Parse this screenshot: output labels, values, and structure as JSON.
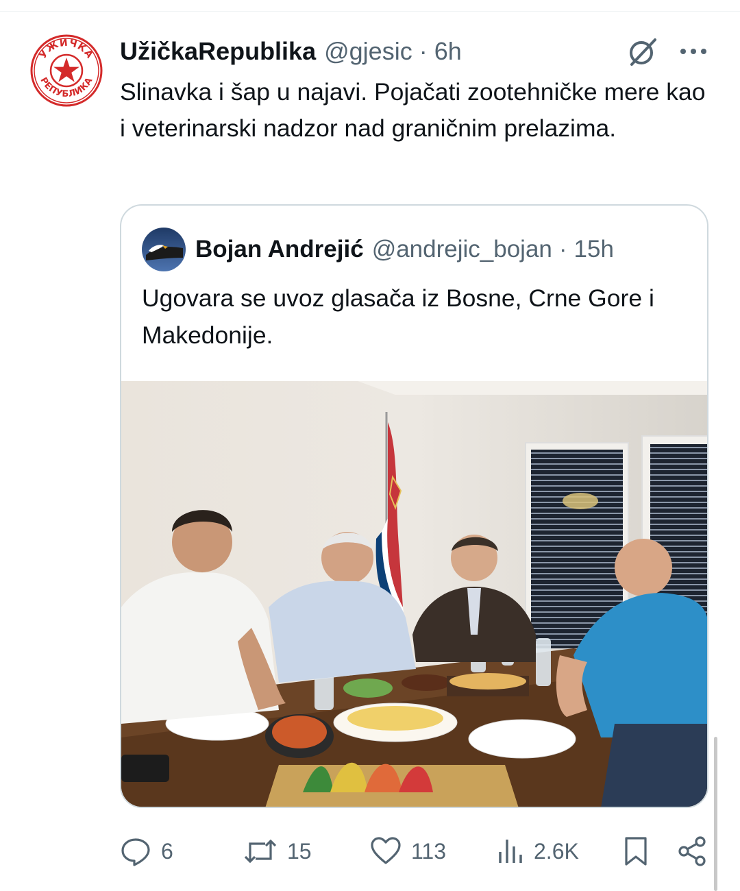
{
  "tweet": {
    "display_name": "UžičkaRepublika",
    "handle": "@gjesic",
    "separator": "·",
    "time": "6h",
    "text": "Slinavka i šap u najavi. Pojačati zootehničke mere kao i veterinarski nadzor nad graničnim prelazima.",
    "avatar_icon": "uzicka-republika-seal-icon",
    "avatar_text_top": "УЖИЧКА",
    "avatar_text_bottom": "РЕПУБЛИКА"
  },
  "quoted_tweet": {
    "display_name": "Bojan Andrejić",
    "handle": "@andrejic_bojan",
    "separator": "·",
    "time": "15h",
    "text": "Ugovara se uvoz glasača iz Bosne, Crne Gore i Makedonije.",
    "avatar_icon": "eagle-avatar-icon",
    "image": "photo-of-four-men-at-dinner-table-with-serbian-flag"
  },
  "actions": {
    "reply_count": "6",
    "retweet_count": "15",
    "like_count": "113",
    "views_count": "2.6K"
  },
  "icons": [
    "grok-icon",
    "more-icon",
    "reply-icon",
    "retweet-icon",
    "like-icon",
    "views-icon",
    "bookmark-icon",
    "share-icon"
  ],
  "colors": {
    "text_primary": "#0f1419",
    "text_secondary": "#536471",
    "border": "#cfd9de",
    "seal_red": "#d42a2a"
  }
}
